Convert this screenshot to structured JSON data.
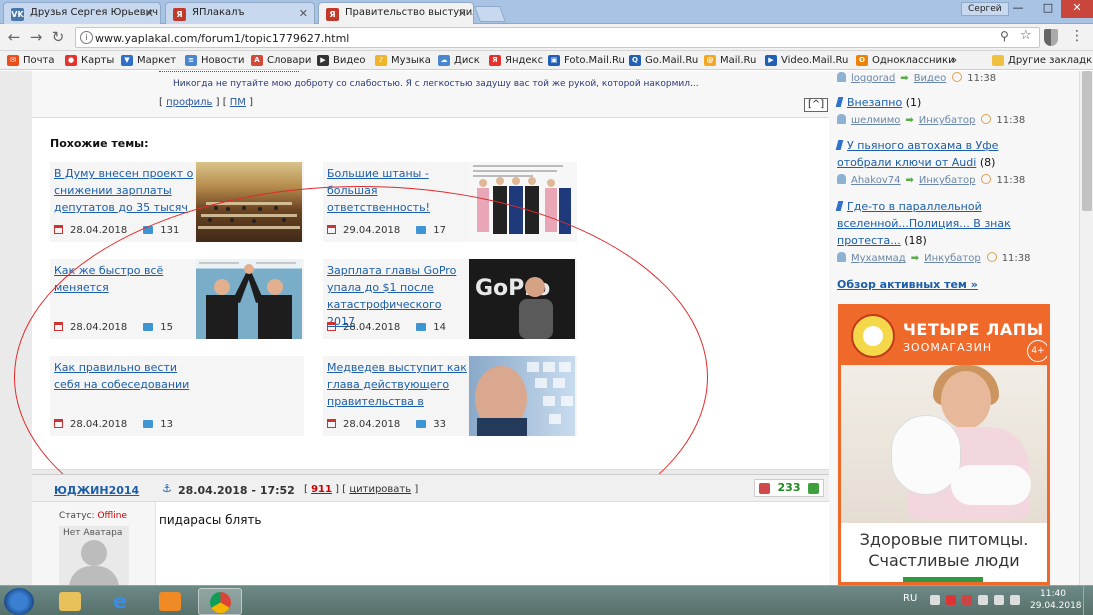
{
  "tabs": [
    {
      "label": "Друзья Сергея Юрьевич",
      "icon": "vk-icon",
      "color": "#4a76a8",
      "glyph": "VK"
    },
    {
      "label": "ЯПлакалъ",
      "icon": "yaplakal-icon",
      "color": "#c0392b",
      "glyph": "Я"
    },
    {
      "label": "Правительство выступил",
      "icon": "yaplakal-icon",
      "color": "#c0392b",
      "glyph": "Я"
    }
  ],
  "window": {
    "user": "Сергей",
    "minimize": "—",
    "maximize": "□",
    "close": "✕"
  },
  "address": {
    "url": "www.yaplakal.com/forum1/topic1779627.html"
  },
  "nav": {
    "back": "←",
    "forward": "→",
    "reload": "↻",
    "zoom": "⚲",
    "star": "☆",
    "menu": "⋮"
  },
  "bookmarks": [
    {
      "label": "Почта",
      "icon": "mail-icon",
      "color": "#e94e1b"
    },
    {
      "label": "Карты",
      "icon": "map-pin-icon",
      "color": "#e5322d"
    },
    {
      "label": "Маркет",
      "icon": "cart-icon",
      "color": "#2f6fc7"
    },
    {
      "label": "Новости",
      "icon": "news-icon",
      "color": "#4a86cf"
    },
    {
      "label": "Словари",
      "icon": "dictionary-icon",
      "color": "#d34a3a"
    },
    {
      "label": "Видео",
      "icon": "video-icon",
      "color": "#333333"
    },
    {
      "label": "Музыка",
      "icon": "music-icon",
      "color": "#f0b429"
    },
    {
      "label": "Диск",
      "icon": "disk-icon",
      "color": "#4a86cf"
    },
    {
      "label": "Яндекс",
      "icon": "yandex-icon",
      "color": "#e5322d"
    },
    {
      "label": "Foto.Mail.Ru",
      "icon": "foto-mail-icon",
      "color": "#1f5fb8"
    },
    {
      "label": "Go.Mail.Ru",
      "icon": "go-mail-icon",
      "color": "#1f5fb8"
    },
    {
      "label": "Mail.Ru",
      "icon": "mail-ru-icon",
      "color": "#f5a623"
    },
    {
      "label": "Video.Mail.Ru",
      "icon": "video-mail-icon",
      "color": "#1f5fb8"
    },
    {
      "label": "Одноклассники",
      "icon": "odnoklassniki-icon",
      "color": "#ee8208"
    }
  ],
  "bookmarks_more": "»",
  "bookmarks_other": "Другие закладки",
  "post1": {
    "quote": "Никогда не путайте мою доброту со слабостью. Я с легкостью задушу вас той же рукой, которой накормил...",
    "profile": "профиль",
    "pm": "ПМ",
    "up": "[^]"
  },
  "similar": {
    "title": "Похожие темы:",
    "items": [
      {
        "title": "В Думу внесен проект о снижении зарплаты депутатов до 35 тысяч",
        "date": "28.04.2018",
        "comments": "131",
        "image": "parliament-photo"
      },
      {
        "title": "Большие штаны - большая ответственность!",
        "date": "29.04.2018",
        "comments": "17",
        "image": "leaders-photo"
      },
      {
        "title": "Как же быстро всё меняется",
        "date": "28.04.2018",
        "comments": "15",
        "image": "handshake-photo"
      },
      {
        "title": "Зарплата главы GoPro упала до $1 после катастрофического 2017",
        "date": "28.04.2018",
        "comments": "14",
        "image": "gopro-photo",
        "image_text": "GoPro"
      },
      {
        "title": "Как правильно вести себя на собеседовании",
        "date": "28.04.2018",
        "comments": "13"
      },
      {
        "title": "Медведев выступит как глава действующего правительства в",
        "date": "28.04.2018",
        "comments": "33",
        "image": "putin-photo"
      }
    ]
  },
  "post2": {
    "author": "ЮДЖИН2014",
    "anchor": "⚓",
    "datetime": "28.04.2018 - 17:52",
    "post_number": "911",
    "quote_label": "цитировать",
    "rating": "233",
    "status_label": "Статус:",
    "status_value": "Offline",
    "no_avatar": "Нет Аватара",
    "text": "пидарасы блять"
  },
  "sidebar": {
    "topics": [
      {
        "user": "loggorad",
        "category": "Видео",
        "time": "11:38"
      },
      {
        "title": "Внезапно",
        "count": "(1)",
        "user": "шелмимо",
        "category": "Инкубатор",
        "time": "11:38"
      },
      {
        "title_line1": "У пьяного автохама в Уфе",
        "title_line2": "отобрали ключи от Audi",
        "count": "(8)",
        "user": "Ahakov74",
        "category": "Инкубатор",
        "time": "11:38"
      },
      {
        "title_line1": "Где-то в параллельной",
        "title_line2": "вселенной...Полиция... В знак",
        "title_line3": "протеста...",
        "count": "(18)",
        "user": "Мухаммад",
        "category": "Инкубатор",
        "time": "11:38"
      }
    ],
    "overview": "Обзор активных тем »",
    "ad": {
      "brand": "ЧЕТЫРЕ ЛАПЫ",
      "subtitle": "ЗООМАГАЗИН",
      "age": "4+",
      "text_line1": "Здоровые питомцы.",
      "text_line2": "Счастливые люди",
      "accent": "#ef6a2a"
    }
  },
  "taskbar": {
    "lang": "RU",
    "time": "11:40",
    "date": "29.04.2018"
  }
}
